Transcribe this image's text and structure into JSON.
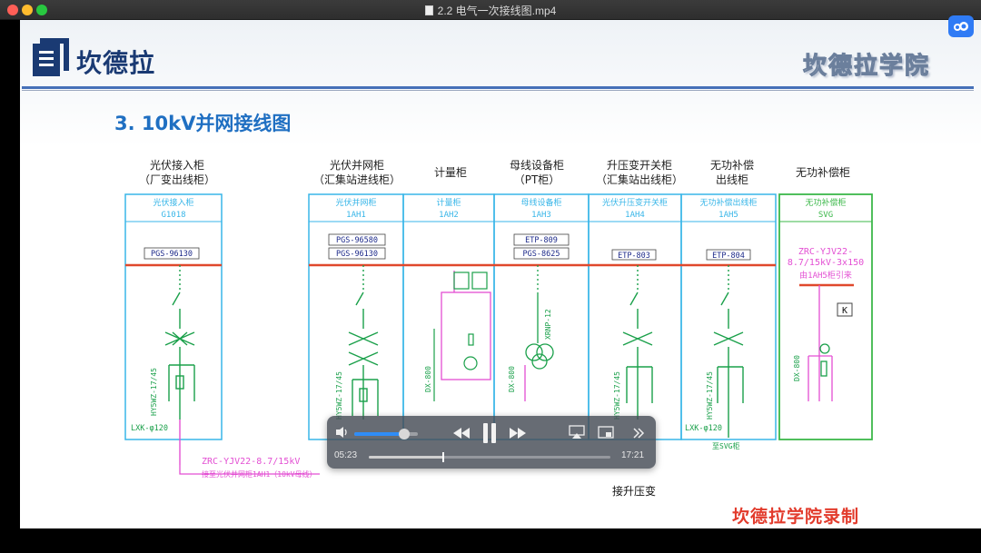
{
  "window": {
    "title": "2.2 电气一次接线图.mp4"
  },
  "slide": {
    "logo_text": "坎德拉",
    "academy": "坎德拉学院",
    "title": "3. 10kV并网接线图",
    "columns": [
      {
        "line1": "光伏接入柜",
        "line2": "（厂变出线柜）"
      },
      {
        "line1": "光伏并网柜",
        "line2": "（汇集站进线柜）"
      },
      {
        "line1": "计量柜",
        "line2": ""
      },
      {
        "line1": "母线设备柜",
        "line2": "（PT柜）"
      },
      {
        "line1": "升压变开关柜",
        "line2": "（汇集站出线柜）"
      },
      {
        "line1": "无功补偿",
        "line2": "出线柜"
      },
      {
        "line1": "无功补偿柜",
        "line2": ""
      }
    ],
    "panels": [
      {
        "name": "光伏接入柜",
        "code": "G1018"
      },
      {
        "name": "光伏并网柜",
        "code": "1AH1"
      },
      {
        "name": "计量柜",
        "code": "1AH2"
      },
      {
        "name": "母线设备柜",
        "code": "1AH3"
      },
      {
        "name": "光伏升压变开关柜",
        "code": "1AH4"
      },
      {
        "name": "无功补偿出线柜",
        "code": "1AH5"
      },
      {
        "name": "无功补偿柜",
        "code": "SVG"
      }
    ],
    "protection": [
      "PGS-96130",
      "PGS-96580",
      "PGS-96130",
      "ETP-809",
      "PGS-8625",
      "ETP-803",
      "ETP-804"
    ],
    "svg_cable": [
      "ZRC-YJV22-",
      "8.7/15kV-3x150",
      "由1AH5柜引来"
    ],
    "svg_box": "K",
    "cable_main": "ZRC-YJV22-8.7/15kV",
    "cable_note": "接至光伏并网柜1AH1（10kV母线）",
    "arrester_a": "HY5WZ-17/45",
    "ct_a": "LXK-φ120",
    "pt_label": "XRNP-12",
    "lightning_d": "DX-800",
    "to_svg": "至SVG柜",
    "bottom_note": "接升压变",
    "watermark": "坎德拉学院录制"
  },
  "player": {
    "elapsed": "05:23",
    "total": "17:21",
    "progress": 0.31,
    "volume": 0.78
  },
  "colors": {
    "bus": "#e0482c",
    "panel_border": "#38b6e8",
    "svg_border": "#3cb84a",
    "wire_green": "#1aa04a",
    "wire_magenta": "#e34fd3",
    "title_blue": "#1f6fc2"
  }
}
